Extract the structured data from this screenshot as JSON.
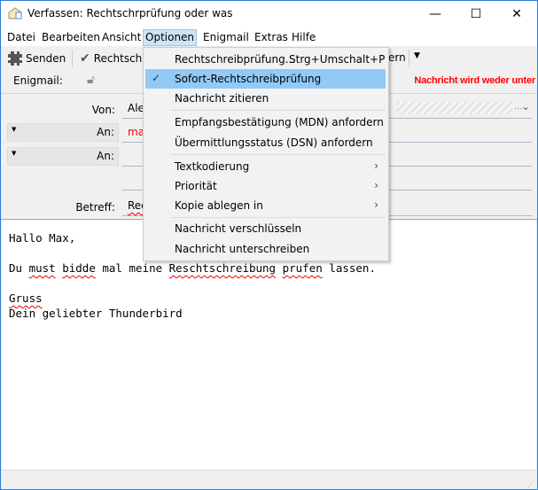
{
  "window": {
    "title": "Verfassen: Rechtschrprüfung oder was"
  },
  "menubar": [
    "Datei",
    "Bearbeiten",
    "Ansicht",
    "Optionen",
    "Enigmail",
    "Extras",
    "Hilfe"
  ],
  "toolbar": {
    "send": "Senden",
    "spell": "Rechtschr",
    "right_partial": "ern"
  },
  "enigmail": {
    "label": "Enigmail:",
    "status": "Nachricht wird weder unter"
  },
  "headers": {
    "from_label": "Von:",
    "from_value": "Ale",
    "to_label": "An:",
    "to_value": "ma",
    "to2_label": "An:",
    "subject_label": "Betreff:",
    "subject_value": "Rec",
    "ellipsis": "..."
  },
  "options_menu": {
    "spellcheck": "Rechtschreibprüfung...",
    "spellcheck_shortcut": "Strg+Umschalt+P",
    "auto_spellcheck": "Sofort-Rechtschreibprüfung",
    "quote": "Nachricht zitieren",
    "mdn": "Empfangsbestätigung (MDN) anfordern",
    "dsn": "Übermittlungsstatus (DSN) anfordern",
    "encoding": "Textkodierung",
    "priority": "Priorität",
    "copy": "Kopie ablegen in",
    "encrypt": "Nachricht verschlüsseln",
    "sign": "Nachricht unterschreiben"
  },
  "body": {
    "l1": "Hallo Max,",
    "l3": [
      "Du ",
      "must",
      " ",
      "bidde",
      " mal meine ",
      "Reschtschreibung",
      " ",
      "prufen",
      " lassen."
    ],
    "l5": "Gruss",
    "l6": "Dein geliebter Thunderbird"
  },
  "colors": {
    "accent": "#2b7bd6",
    "highlight": "#91c9f7",
    "warning": "#ff0000"
  }
}
